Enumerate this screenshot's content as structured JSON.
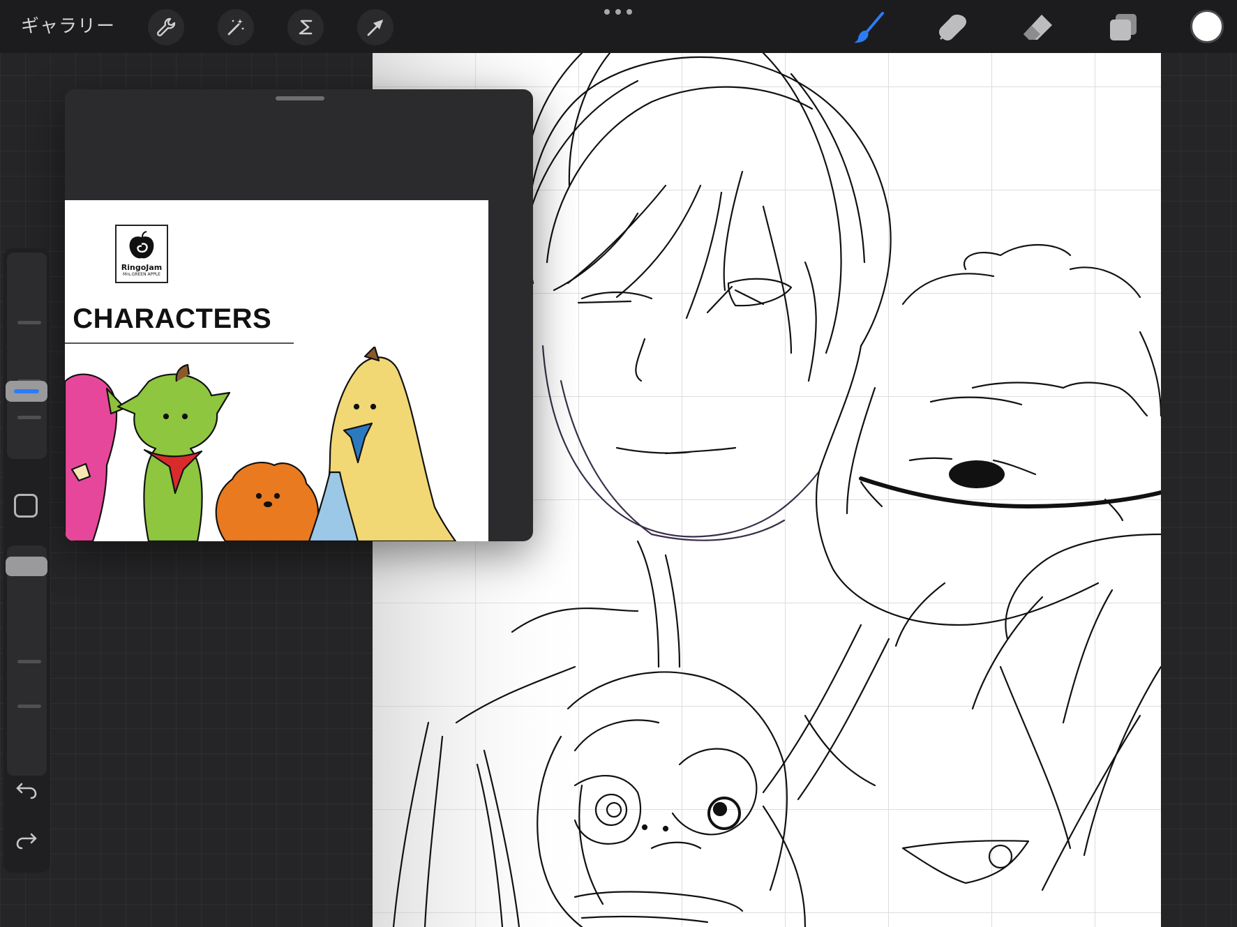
{
  "topbar": {
    "gallery_label": "ギャラリー",
    "left_tools": [
      "wrench-icon",
      "magic-wand-icon",
      "selection-s-icon",
      "transform-arrow-icon"
    ],
    "right_tools": [
      "brush-icon",
      "smudge-icon",
      "eraser-icon",
      "layers-icon"
    ],
    "active_tool": "brush-icon",
    "active_color": "#ffffff",
    "accent": "#2d7cf6"
  },
  "reference": {
    "logo_name": "RingoJam",
    "logo_sub": "Mrs.GREEN APPLE",
    "title": "/ CHARACTERS"
  },
  "sidebar": {
    "controls": [
      "brush-size-slider",
      "modify-button",
      "opacity-slider",
      "undo-icon",
      "redo-icon"
    ]
  }
}
